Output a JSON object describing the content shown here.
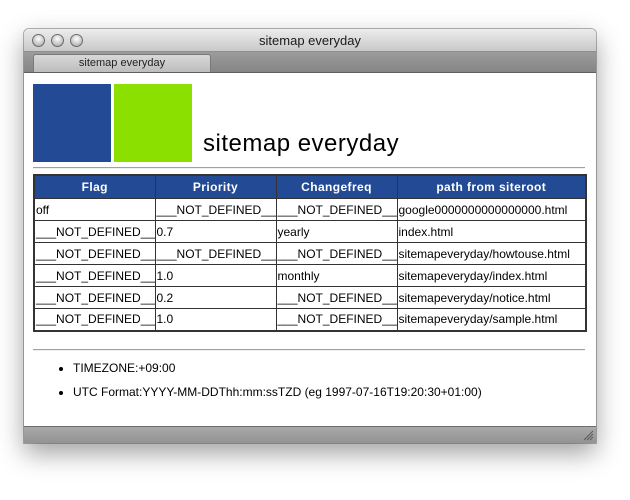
{
  "window": {
    "title": "sitemap everyday"
  },
  "tab": {
    "label": "sitemap everyday"
  },
  "page": {
    "title": "sitemap everyday"
  },
  "colors": {
    "logo_blue": "#234a94",
    "logo_green": "#8ce000",
    "table_header": "#234a94"
  },
  "table": {
    "headers": [
      "Flag",
      "Priority",
      "Changefreq",
      "path from siteroot"
    ],
    "rows": [
      [
        "off",
        "___NOT_DEFINED___",
        "___NOT_DEFINED___",
        "google0000000000000000.html"
      ],
      [
        "___NOT_DEFINED___",
        "0.7",
        "yearly",
        "index.html"
      ],
      [
        "___NOT_DEFINED___",
        "___NOT_DEFINED___",
        "___NOT_DEFINED___",
        "sitemapeveryday/howtouse.html"
      ],
      [
        "___NOT_DEFINED___",
        "1.0",
        "monthly",
        "sitemapeveryday/index.html"
      ],
      [
        "___NOT_DEFINED___",
        "0.2",
        "___NOT_DEFINED___",
        "sitemapeveryday/notice.html"
      ],
      [
        "___NOT_DEFINED___",
        "1.0",
        "___NOT_DEFINED___",
        "sitemapeveryday/sample.html"
      ]
    ]
  },
  "notes": {
    "timezone": "TIMEZONE:+09:00",
    "utc_format": "UTC Format:YYYY-MM-DDThh:mm:ssTZD (eg 1997-07-16T19:20:30+01:00)"
  },
  "icons": {
    "close": "close-icon",
    "minimize": "minimize-icon",
    "zoom": "zoom-icon",
    "resize": "resize-grip-icon"
  }
}
